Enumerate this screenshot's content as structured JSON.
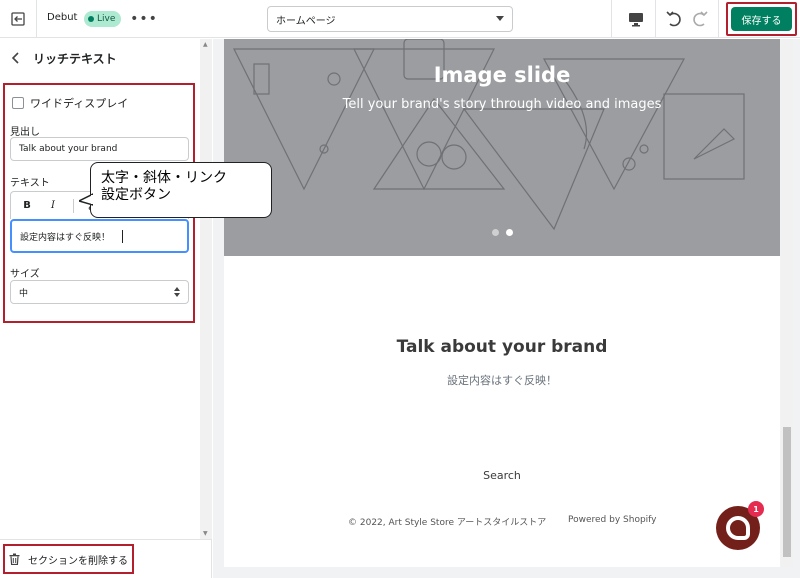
{
  "topbar": {
    "theme_name": "Debut",
    "live_label": "Live",
    "more_label": "•••",
    "page_select_value": "ホームページ",
    "save_label": "保存する"
  },
  "sidebar": {
    "title": "リッチテキスト",
    "wide_display_label": "ワイドディスプレイ",
    "wide_display_checked": false,
    "heading_label": "見出し",
    "heading_value": "Talk about your brand",
    "text_label": "テキスト",
    "text_value": "設定内容はすぐ反映！",
    "toolbar": {
      "bold": "B",
      "italic": "I"
    },
    "size_label": "サイズ",
    "size_value": "中",
    "delete_label": "セクションを削除する"
  },
  "callout": {
    "line1": "太字・斜体・リンク",
    "line2": "設定ボタン"
  },
  "preview": {
    "hero_title": "Image slide",
    "hero_subtitle": "Tell your brand's story through video and images",
    "rich_text_heading": "Talk about your brand",
    "rich_text_body": "設定内容はすぐ反映！",
    "footer_search": "Search",
    "footer_copyright": "© 2022, Art Style Store アートスタイルストア",
    "footer_powered": "Powered by Shopify",
    "chat_badge": "1"
  }
}
